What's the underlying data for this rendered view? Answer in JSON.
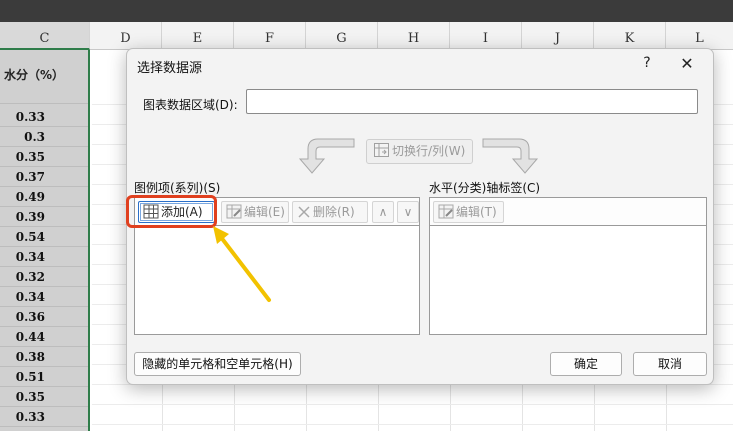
{
  "columns": [
    "C",
    "D",
    "E",
    "F",
    "G",
    "H",
    "I",
    "J",
    "K",
    "L"
  ],
  "column_c": {
    "header": "水分（%）",
    "values": [
      "0.33",
      "0.3",
      "0.35",
      "0.37",
      "0.49",
      "0.39",
      "0.54",
      "0.34",
      "0.32",
      "0.34",
      "0.36",
      "0.44",
      "0.38",
      "0.51",
      "0.35",
      "0.33"
    ]
  },
  "dialog": {
    "title": "选择数据源",
    "help_label": "?",
    "close_label": "✕",
    "range_label": "图表数据区域(D):",
    "range_value": "",
    "range_picker_icon": "collapse-dialog-icon",
    "switch_button_label": "切换行/列(W)",
    "legend_section_label": "图例项(系列)(S)",
    "axis_section_label": "水平(分类)轴标签(C)",
    "legend_toolbar": {
      "add_label": "添加(A)",
      "edit_label": "编辑(E)",
      "delete_label": "删除(R)",
      "move_up_label": "∧",
      "move_down_label": "∨"
    },
    "axis_toolbar": {
      "edit_label": "编辑(T)"
    },
    "hidden_cells_button_label": "隐藏的单元格和空单元格(H)",
    "ok_label": "确定",
    "cancel_label": "取消"
  },
  "colors": {
    "highlight": "#e0401f",
    "annotation_arrow": "#f2c200",
    "selected_column_border": "#2f7d4a"
  }
}
